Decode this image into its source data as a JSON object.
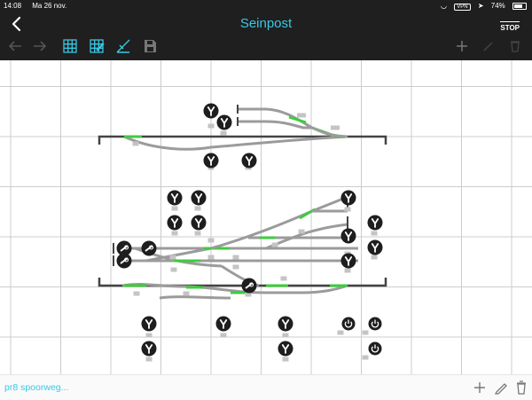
{
  "status_bar": {
    "time": "14:08",
    "date": "Ma 26 nov.",
    "vpn": "VPN",
    "battery": "74%"
  },
  "header": {
    "title": "Seinpost",
    "stop_label": "STOP",
    "back_icon": "chevron-left-icon",
    "toolbar_left": [
      "arrow-left-icon",
      "arrow-right-icon",
      "grid-icon",
      "grid-edit-icon",
      "ruler-icon",
      "save-icon"
    ],
    "toolbar_right": [
      "plus-icon",
      "pencil-icon",
      "trash-icon"
    ]
  },
  "layout": {
    "grid_visible": true,
    "colors": {
      "accent": "#36c9e6",
      "header_bg": "#1f1f1f",
      "track": "#9b9b9b",
      "track_active": "#3ccc3c",
      "buffer": "#444444",
      "signal": "#1e1e1e"
    },
    "signal_count": 22,
    "decoupler_count": 3,
    "power_button_count": 3
  },
  "bottom_bar": {
    "project_name": "pr8 spoorweg...",
    "actions": [
      "plus-icon",
      "pencil-icon",
      "trash-icon"
    ]
  }
}
